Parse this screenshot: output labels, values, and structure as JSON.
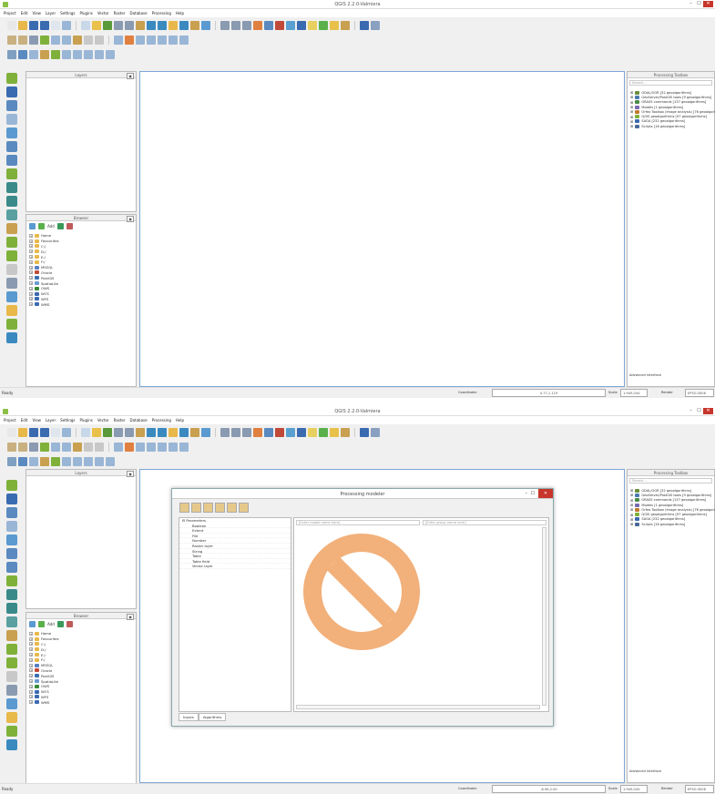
{
  "window": {
    "title": "QGIS 2.2.0-Valmiera",
    "minimize": "–",
    "maximize": "☐",
    "close": "✕"
  },
  "menu": [
    "Project",
    "Edit",
    "View",
    "Layer",
    "Settings",
    "Plugins",
    "Vector",
    "Raster",
    "Database",
    "Processing",
    "Help"
  ],
  "panels": {
    "layers_title": "Layers",
    "browser_title": "Browser",
    "browser_add": "Add",
    "float_label": "▣",
    "close_label": "✕"
  },
  "browser_tree": [
    {
      "label": "Home",
      "color": "#e8b84a"
    },
    {
      "label": "Favourites",
      "color": "#e8b84a"
    },
    {
      "label": "C:/",
      "color": "#e8b84a"
    },
    {
      "label": "D:/",
      "color": "#e8b84a"
    },
    {
      "label": "E:/",
      "color": "#e8b84a"
    },
    {
      "label": "F:/",
      "color": "#e8b84a"
    },
    {
      "label": "MSSQL",
      "color": "#5a7fc0"
    },
    {
      "label": "Oracle",
      "color": "#c04a3a"
    },
    {
      "label": "PostGIS",
      "color": "#3a6fb0"
    },
    {
      "label": "SpatiaLite",
      "color": "#6a9ad0"
    },
    {
      "label": "OWS",
      "color": "#3a8a3a"
    },
    {
      "label": "WCS",
      "color": "#3a6ab0"
    },
    {
      "label": "WFS",
      "color": "#3a6ab0"
    },
    {
      "label": "WMS",
      "color": "#3a6ab0"
    }
  ],
  "toolbox": {
    "title": "Processing Toolbox",
    "search_placeholder": "Search...",
    "items": [
      {
        "label": "GDAL/OGR [32 geoalgorithms]",
        "color": "#6a8f3a"
      },
      {
        "label": "GeoServer/PostGIS tools [9 geoalgorithms]",
        "color": "#4a7ab0"
      },
      {
        "label": "GRASS commands [137 geoalgorithms]",
        "color": "#4a8a4a"
      },
      {
        "label": "Models [1 geoalgorithms]",
        "color": "#7a6ab0"
      },
      {
        "label": "Orfeo Toolbox (Image analysis) [76 geoalgorithms]",
        "color": "#c07a30"
      },
      {
        "label": "QGIS geoalgorithms [97 geoalgorithms]",
        "color": "#7fb13a"
      },
      {
        "label": "SAGA [232 geoalgorithms]",
        "color": "#3a6ab0"
      },
      {
        "label": "Scripts [16 geoalgorithms]",
        "color": "#4a6a9a"
      }
    ],
    "advanced": "Advanced interface"
  },
  "status": {
    "ready": "Ready",
    "coordinate_label": "Coordinate:",
    "coordinate_value": "4.77,1.119",
    "coordinate_value_2": "-6.96,2.00",
    "scale_label": "Scale",
    "scale_value": "1:949,044",
    "render_label": "Render",
    "crs": "EPSG:3006"
  },
  "modeler": {
    "title": "Processing modeler",
    "min": "–",
    "max": "☐",
    "close": "✕",
    "root": "Parameters",
    "params": [
      "Boolean",
      "Extent",
      "File",
      "Number",
      "Raster layer",
      "String",
      "Table",
      "Table field",
      "Vector layer"
    ],
    "name_placeholder": "[Enter model name here]",
    "group_placeholder": "[Enter group name here]",
    "tab_inputs": "Inputs",
    "tab_algorithms": "Algorithms"
  },
  "colors": {
    "no_entry": "#f2b07a",
    "close_red": "#c7352b",
    "map_border": "#7fa7d6"
  }
}
